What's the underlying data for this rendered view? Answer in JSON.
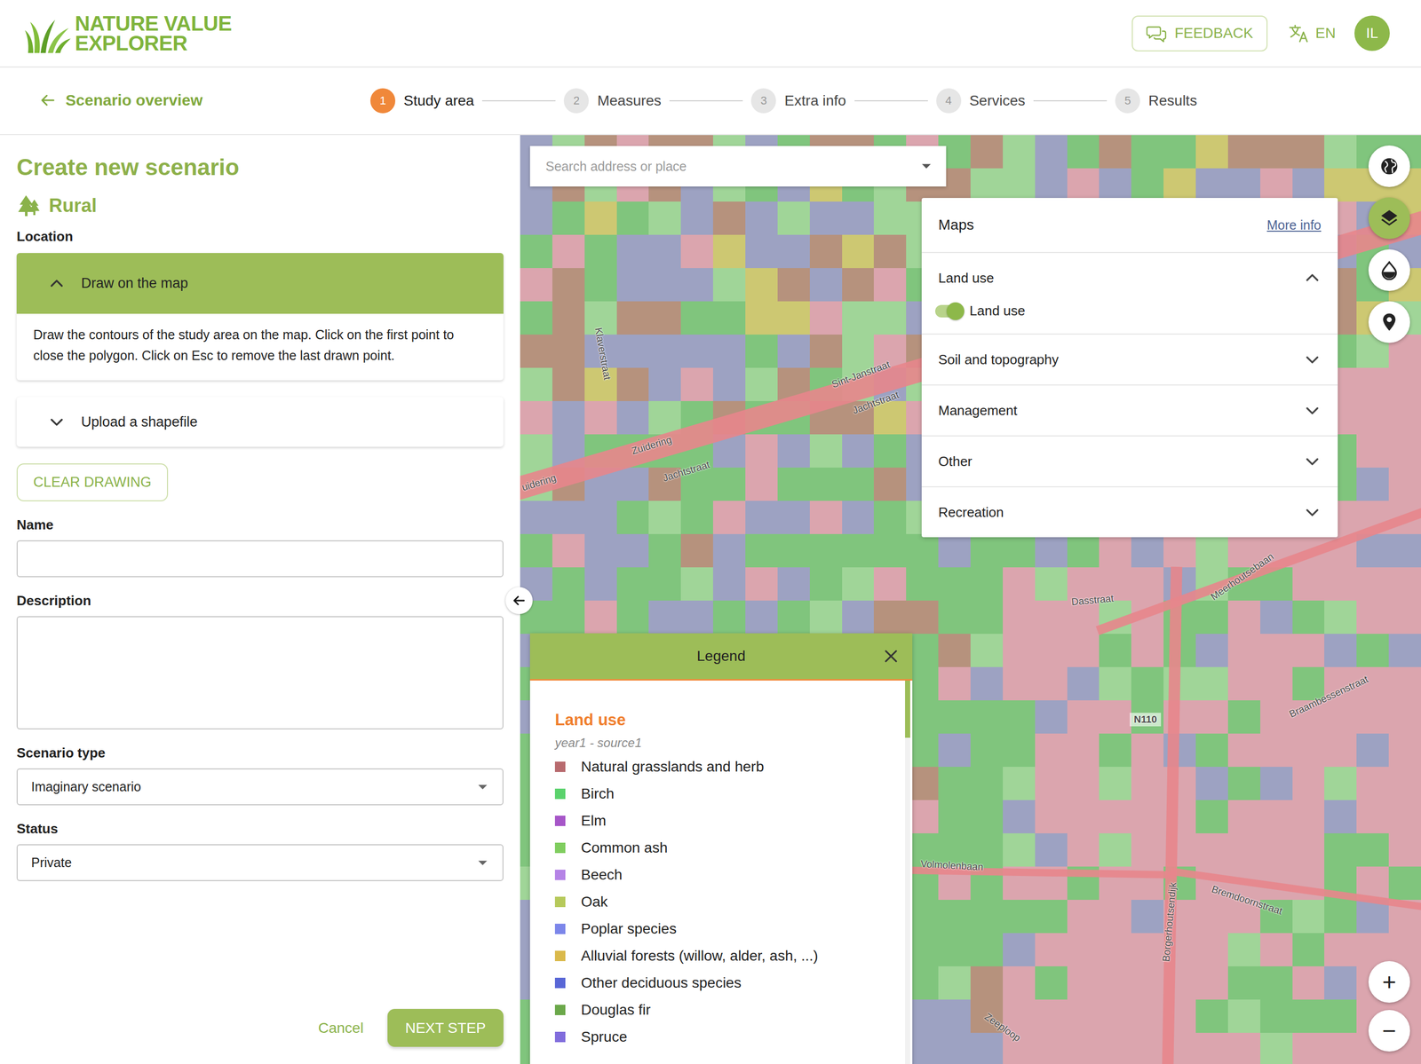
{
  "header": {
    "logo_line1": "NATURE VALUE",
    "logo_line2": "EXPLORER",
    "feedback": "FEEDBACK",
    "language": "EN",
    "avatar": "IL"
  },
  "nav": {
    "back": "Scenario overview"
  },
  "steps": [
    {
      "number": "1",
      "label": "Study area",
      "selected": true
    },
    {
      "number": "2",
      "label": "Measures",
      "selected": false
    },
    {
      "number": "3",
      "label": "Extra info",
      "selected": false
    },
    {
      "number": "4",
      "label": "Services",
      "selected": false
    },
    {
      "number": "5",
      "label": "Results",
      "selected": false
    }
  ],
  "form": {
    "title": "Create new scenario",
    "category": "Rural",
    "location_label": "Location",
    "location_options": [
      {
        "label": "Draw on the map",
        "expanded": true,
        "description": "Draw the contours of the study area on the map. Click on the first point to close the polygon. Click on Esc to remove the last drawn point."
      },
      {
        "label": "Upload a shapefile",
        "expanded": false
      }
    ],
    "clear_drawing": "CLEAR DRAWING",
    "name": {
      "label": "Name",
      "value": ""
    },
    "description": {
      "label": "Description",
      "value": ""
    },
    "scenario_type": {
      "label": "Scenario type",
      "value": "Imaginary scenario"
    },
    "status": {
      "label": "Status",
      "value": "Private"
    },
    "cancel": "Cancel",
    "next": "NEXT STEP"
  },
  "map": {
    "search": {
      "placeholder": "Search address or place"
    },
    "panel": {
      "title": "Maps",
      "more_info": "More info",
      "groups": [
        {
          "label": "Land use",
          "expanded": true,
          "layers": [
            {
              "label": "Land use",
              "on": true
            }
          ]
        },
        {
          "label": "Soil and topography",
          "expanded": false
        },
        {
          "label": "Management",
          "expanded": false
        },
        {
          "label": "Other",
          "expanded": false
        },
        {
          "label": "Recreation",
          "expanded": false
        }
      ]
    },
    "tools": [
      {
        "kind": "globe",
        "selected": false
      },
      {
        "kind": "layers",
        "selected": true
      },
      {
        "kind": "water",
        "selected": false
      },
      {
        "kind": "pin",
        "selected": false
      }
    ],
    "zoom_in": "+",
    "zoom_out": "−",
    "labels": [
      "Klaverstraat",
      "Sint-Janstraat",
      "Zuidering",
      "Jachtstraat",
      "uidering",
      "Jachtstraat",
      "Dasstraat",
      "Meerhoutsebaan",
      "N110",
      "Braambessenstraat",
      "Borgerhoutsendijk",
      "Volmolenbaan",
      "Bremdoornstraat",
      "Zeeploop"
    ],
    "legend": {
      "title": "Legend",
      "layer": "Land use",
      "source": "year1 - source1",
      "items": [
        {
          "label": "Natural grasslands and herb",
          "color": "#b86a6e"
        },
        {
          "label": "Birch",
          "color": "#5ad26c"
        },
        {
          "label": "Elm",
          "color": "#a656c8"
        },
        {
          "label": "Common ash",
          "color": "#7fcd5e"
        },
        {
          "label": "Beech",
          "color": "#b583e6"
        },
        {
          "label": "Oak",
          "color": "#b6c95a"
        },
        {
          "label": "Poplar species",
          "color": "#7c86ea"
        },
        {
          "label": "Alluvial forests (willow, alder, ash, ...)",
          "color": "#dab94a"
        },
        {
          "label": "Other deciduous species",
          "color": "#5866d6"
        },
        {
          "label": "Douglas fir",
          "color": "#6ba84a"
        },
        {
          "label": "Spruce",
          "color": "#806cdc"
        }
      ]
    }
  }
}
